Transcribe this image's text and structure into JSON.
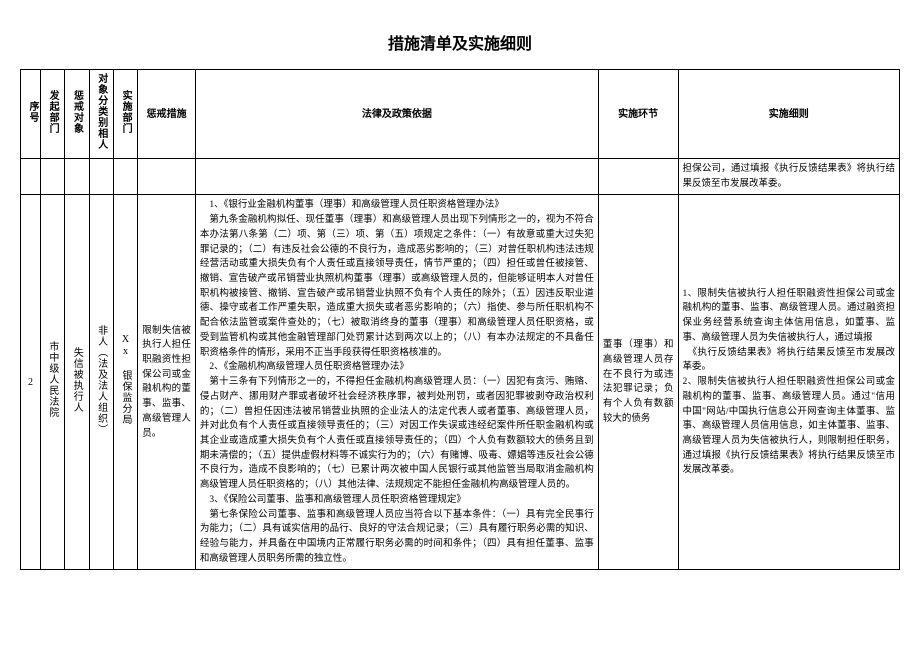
{
  "title": "措施清单及实施细则",
  "headers": {
    "seq": "序号",
    "initiator": "发起部门",
    "target": "惩戒对象",
    "class": "对象分类别相人",
    "implementer": "实施部门",
    "measure": "惩戒措施",
    "basis": "法律及政策依据",
    "step": "实施环节",
    "rules": "实施细则"
  },
  "row_prev": {
    "rules": "担保公司，通过填报《执行反馈结果表》将执行结果反馈至市发展改革委。"
  },
  "row2": {
    "seq": "2",
    "initiator": "市中级人民法院",
    "target": "失信被执行人",
    "class": "非人（法及法人组织）",
    "implementer": "Xx 银保监分局",
    "measure": "限制失信被执行人担任职融资性担保公司或金融机构的董事、监事、高级管理人员。",
    "basis": {
      "p1": "1、《银行业金融机构董事（理事）和高级管理人员任职资格管理办法》",
      "p2": "第九条金融机构拟任、现任董事（理事）和高级管理人员出现下列情形之一的，视为不符合本办法第八条第（二）项、第（三）项、第（五）项规定之条件：（一）有故意或重大过失犯罪记录的；（二）有违反社会公德的不良行为，造成恶劣影响的；（三）对曾任职机构违法违规经营活动或重大损失负有个人责任或直接领导责任，情节严重的；（四）担任或曾任被接管、撤销、宣告破产或吊销营业执照机构董事（理事）或高级管理人员的，但能够证明本人对曾任职机构被接管、撤销、宣告破产或吊销营业执照不负有个人责任的除外；（五）因违反职业道德、操守或者工作严重失职，造成重大损失或者恶劣影响的；（六）指使、参与所任职机构不配合依法监管或案件查处的；（七）被取消终身的董事（理事）和高级管理人员任职资格，或受到监管机构或其他金融管理部门处罚累计达到两次以上的；（八）有本办法规定的不具备任职资格条件的情形，采用不正当手段获得任职资格核准的。",
      "p3": "2、《金融机构高级管理人员任职资格管理办法》",
      "p4": "第十三条有下列情形之一的，不得担任金融机构高级管理人员：（一）因犯有贪污、贿赂、侵占财产、挪用财产罪或者破坏社会经济秩序罪，被判处刑罚，或者因犯罪被剥夺政治权利的；（二）曾担任因违法被吊销营业执照的企业法人的法定代表人或者董事、高级管理人员，并对此负有个人责任或直接领导责任的；（三）对因工作失误或违经纪案件所任职金融机构或其企业或造成重大损失负有个人责任或直接领导责任的；（四）个人负有数额较大的债务且到期未清偿的；（五）提供虚假材料等不诚实行为的；（六）有赌博、吸毒、嫖娼等违反社会公德不良行为，造成不良影响的；（七）已累计两次被中国人民银行或其他监管当局取消金融机构高级管理人员任职资格的；（八）其他法律、法规规定不能担任金融机构高级管理人员的。",
      "p5": "3、《保险公司董事、监事和高级管理人员任职资格管理规定》",
      "p6": "第七条保险公司董事、监事和高级管理人员应当符合以下基本条件：（一）具有完全民事行为能力；（二）具有诚实信用的品行、良好的守法合规记录；（三）具有履行职务必需的知识、经验与能力，并具备在中国境内正常履行职务必需的时间和条件；（四）具有担任董事、监事和高级管理人员职务所需的独立性。"
    },
    "step": "董事（理事）和高级管理人员存在不良行为或违法犯罪记录；负有个人负有数额较大的债务",
    "rules": "1、限制失信被执行人担任职融资性担保公司或金融机构的董事、监事、高级管理人员。通过融资担保业务经营系统查询主体信用信息，如董事、监事、高级管理人员为失信被执行人，通过填报\n　《执行反馈结果表》将执行结果反馈至市发展改革委。\n2、限制失信被执行人担任职融资性担保公司或金融机构的董事、监事、高级管理人员。通过\"信用中国\"网站/中国执行信息公开网查询主体董事、监事、高级管理人员信用信息，如主体董事、监事、高级管理人员为失信被执行人，则限制担任职务，通过填报《执行反馈结果表》将执行结果反馈至市发展改革委。"
  }
}
